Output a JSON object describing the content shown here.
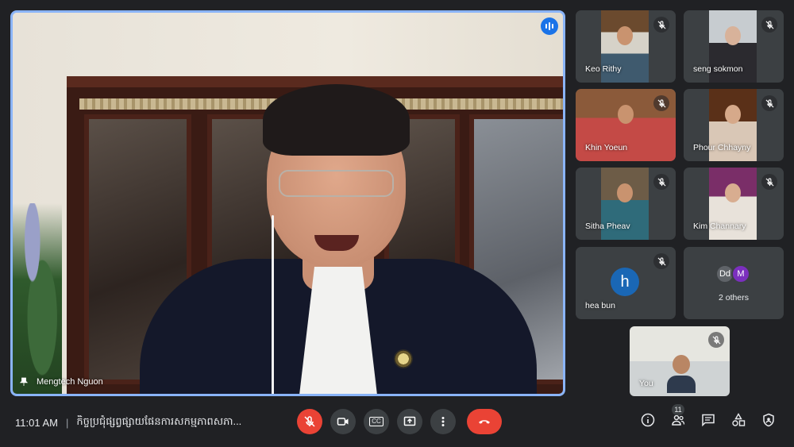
{
  "main_speaker": {
    "name": "Mengtech Nguon"
  },
  "participants": [
    {
      "name": "Keo Rithy"
    },
    {
      "name": "seng sokmon"
    },
    {
      "name": "Khin Yoeun"
    },
    {
      "name": "Phour Chhayny"
    },
    {
      "name": "Sitha Pheav"
    },
    {
      "name": "Kim Channary"
    },
    {
      "name": "hea bun",
      "avatar_letter": "h",
      "avatar_color": "#1a67b5"
    }
  ],
  "others_tile": {
    "avatars": [
      "Dd",
      "M"
    ],
    "label": "2 others"
  },
  "self_tile": {
    "label": "You"
  },
  "bottom_bar": {
    "time": "11:01 AM",
    "separator": "|",
    "meeting_title": "កិច្ចប្រជុំផ្សព្វផ្សាយផែនការសកម្មភាពសភា...",
    "captions_label": "CC",
    "participant_count": "11"
  },
  "colors": {
    "accent": "#8ab4f8",
    "end_call": "#ea4335",
    "bar_bg": "#202124",
    "tile_bg": "#3c4043"
  },
  "icons": {
    "mic_off": "mic-off-icon",
    "camera": "camera-icon",
    "present": "present-icon",
    "more": "more-vert-icon",
    "end_call": "phone-hangup-icon",
    "info": "info-icon",
    "people": "people-icon",
    "chat": "chat-icon",
    "activities": "activities-icon",
    "host_controls": "shield-icon"
  }
}
